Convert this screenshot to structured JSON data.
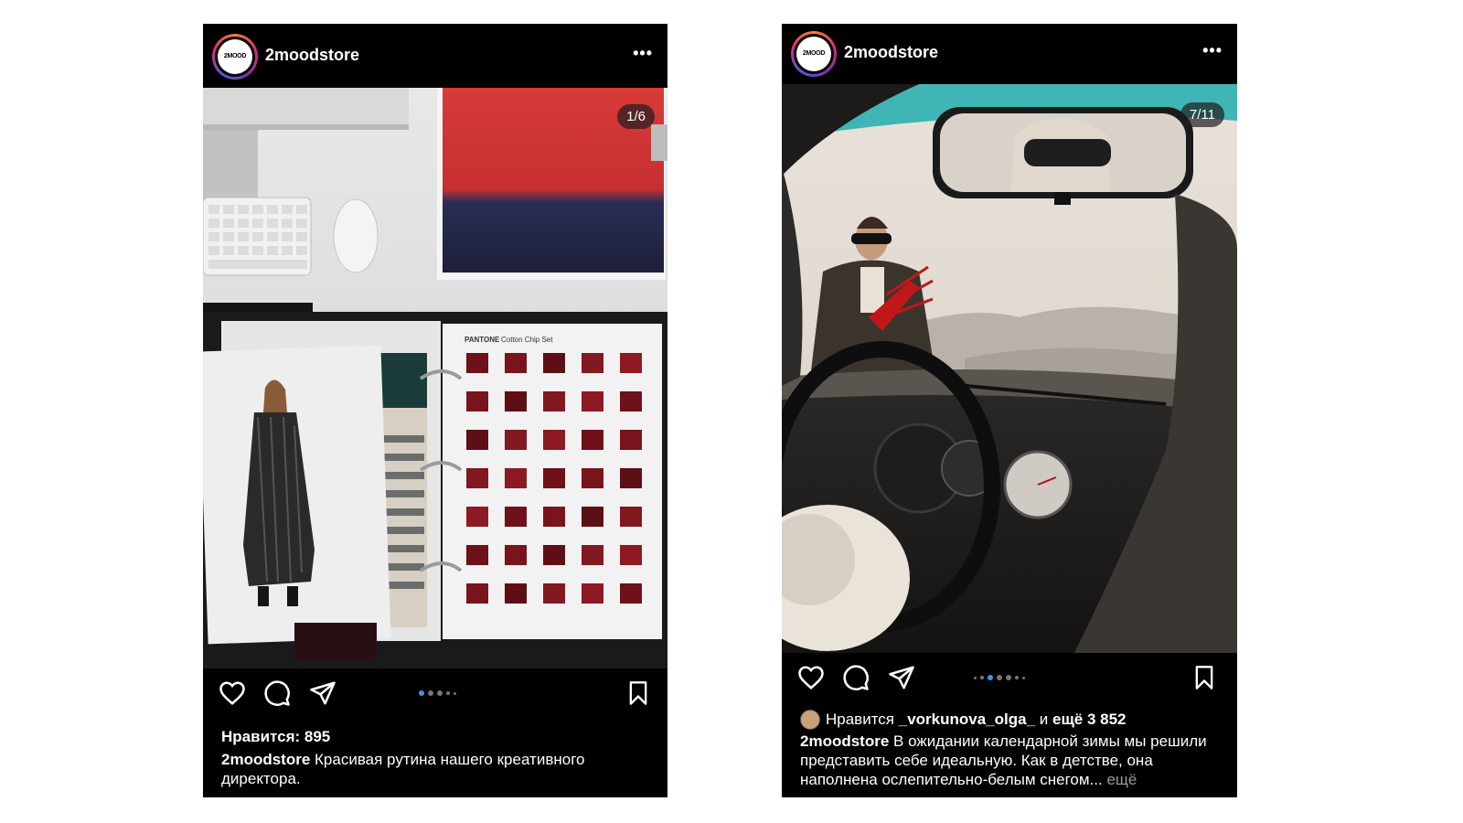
{
  "posts": [
    {
      "username": "2moodstore",
      "avatar_text": "2MOOD",
      "more_label": "•••",
      "counter": "1/6",
      "likes_text": "Нравится: 895",
      "caption_user": "2moodstore",
      "caption_text": " Красивая рутина нашего креативного директора.",
      "image_texts": {
        "pantone_brand": "PANTONE",
        "pantone_title": "Cotton Chip Set"
      }
    },
    {
      "username": "2moodstore",
      "avatar_text": "2MOOD",
      "more_label": "•••",
      "counter": "7/11",
      "likes_prefix": "Нравится ",
      "likes_user": "_vorkunova_olga_",
      "likes_mid": " и ",
      "likes_more": "ещё 3 852",
      "caption_user": "2moodstore",
      "caption_text": " В ожидании календарной зимы мы решили представить себе идеальную. Как в детстве, она наполнена ослепительно-белым снегом...",
      "caption_more": " ещё"
    }
  ],
  "icons": [
    "heart-icon",
    "comment-icon",
    "share-icon",
    "bookmark-icon"
  ],
  "colors": {
    "active_dot": "#3897f0",
    "post_bg": "#000000"
  }
}
